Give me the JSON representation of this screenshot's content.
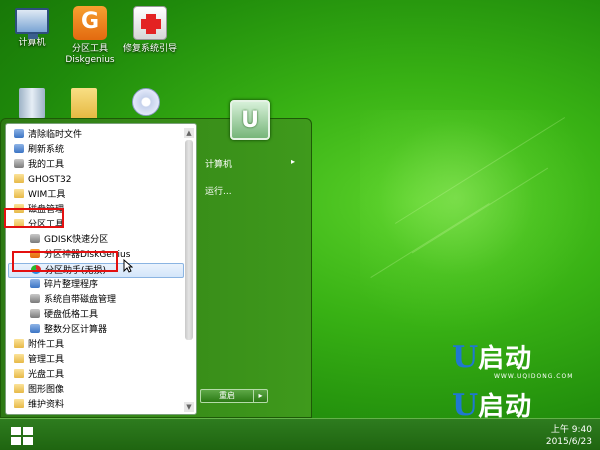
{
  "desktop": {
    "icons": [
      {
        "label": "计算机",
        "label2": ""
      },
      {
        "label": "分区工具",
        "label2": "Diskgenius"
      },
      {
        "label": "修复系统引导",
        "label2": ""
      }
    ]
  },
  "start_menu": {
    "items": [
      {
        "label": "清除临时文件"
      },
      {
        "label": "刷新系统"
      },
      {
        "label": "我的工具"
      },
      {
        "label": "GHOST32"
      },
      {
        "label": "WIM工具"
      },
      {
        "label": "磁盘管理"
      },
      {
        "label": "分区工具"
      },
      {
        "label": "GDISK快速分区"
      },
      {
        "label": "分区神器DiskGenius"
      },
      {
        "label": "分区助手(无损)"
      },
      {
        "label": "碎片整理程序"
      },
      {
        "label": "系统自带磁盘管理"
      },
      {
        "label": "硬盘低格工具"
      },
      {
        "label": "整数分区计算器"
      },
      {
        "label": "附件工具"
      },
      {
        "label": "管理工具"
      },
      {
        "label": "光盘工具"
      },
      {
        "label": "图形图像"
      },
      {
        "label": "维护资料"
      }
    ],
    "right": {
      "computer": "计算机",
      "run": "运行...",
      "arrow": "▸",
      "shutdown": "重启",
      "shutdown_arrow": "▸"
    },
    "avatar_letter": "U"
  },
  "brand": {
    "letter": "U",
    "text": "启动",
    "url": "WWW.UQIDONG.COM"
  },
  "taskbar": {
    "time": "上午 9:40",
    "date": "2015/6/23"
  }
}
